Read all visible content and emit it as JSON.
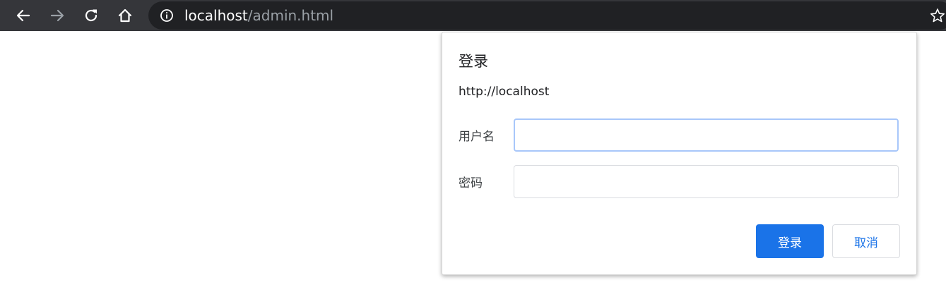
{
  "browser": {
    "url_host": "localhost",
    "url_path": "/admin.html",
    "icons": {
      "back": "back-arrow-icon",
      "forward": "forward-arrow-icon",
      "reload": "reload-icon",
      "home": "home-icon",
      "site_info": "info-icon",
      "bookmark": "star-icon"
    },
    "colors": {
      "toolbar": "#35363a",
      "omnibox": "#202124"
    }
  },
  "dialog": {
    "title": "登录",
    "origin": "http://localhost",
    "username_label": "用户名",
    "username_value": "",
    "password_label": "密码",
    "password_value": "",
    "login_button": "登录",
    "cancel_button": "取消",
    "accent_color": "#1a73e8"
  }
}
